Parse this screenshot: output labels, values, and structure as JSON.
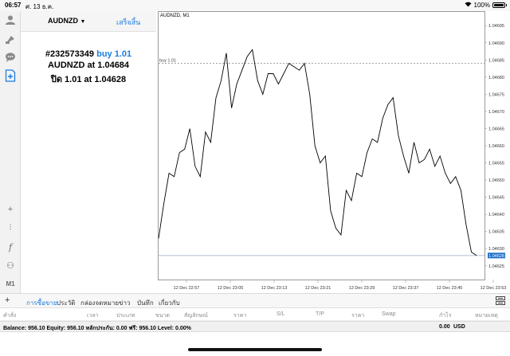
{
  "status": {
    "time": "06:57",
    "date": "ศ. 13 ธ.ค.",
    "battery": "100%"
  },
  "panel": {
    "symbol": "AUDNZD",
    "done": "เสร็จสิ้น",
    "order_id": "#232573349",
    "order_type": "buy 1.01",
    "open_line": "AUDNZD at 1.04684",
    "close_line": "ปิด 1.01 at 1.04628"
  },
  "chart_data": {
    "type": "line",
    "title": "AUDNZD, M1",
    "order_line_label": "buy 1.01",
    "order_price": 1.04684,
    "current_price": 1.04628,
    "ylim": [
      1.04621,
      1.04699
    ],
    "y_ticks": [
      "1.04695",
      "1.04690",
      "1.04685",
      "1.04680",
      "1.04675",
      "1.04670",
      "1.04665",
      "1.04660",
      "1.04655",
      "1.04650",
      "1.04645",
      "1.04640",
      "1.04635",
      "1.04630",
      "1.04625"
    ],
    "y_tick_values": [
      1.04695,
      1.0469,
      1.04685,
      1.0468,
      1.04675,
      1.0467,
      1.04665,
      1.0466,
      1.04655,
      1.0465,
      1.04645,
      1.0464,
      1.04635,
      1.0463,
      1.04625
    ],
    "x_labels": [
      "12 Dec 22:57",
      "12 Dec 23:05",
      "12 Dec 23:13",
      "12 Dec 23:21",
      "12 Dec 23:29",
      "12 Dec 23:37",
      "12 Dec 23:45",
      "12 Dec 23:53"
    ],
    "current_label": "1.04628",
    "values": [
      1.04633,
      1.04643,
      1.04652,
      1.04651,
      1.04658,
      1.04659,
      1.04665,
      1.04654,
      1.04651,
      1.04664,
      1.04661,
      1.04674,
      1.04679,
      1.04687,
      1.04671,
      1.04678,
      1.04682,
      1.04686,
      1.04688,
      1.04679,
      1.04675,
      1.04681,
      1.04681,
      1.04678,
      1.04681,
      1.04684,
      1.04683,
      1.04682,
      1.04684,
      1.04675,
      1.0466,
      1.04655,
      1.04657,
      1.04641,
      1.04636,
      1.04634,
      1.04647,
      1.04644,
      1.04652,
      1.04651,
      1.04658,
      1.04662,
      1.04661,
      1.04668,
      1.04672,
      1.04674,
      1.04663,
      1.04657,
      1.04652,
      1.04661,
      1.04655,
      1.04656,
      1.04659,
      1.04654,
      1.04657,
      1.04652,
      1.04649,
      1.04651,
      1.04647,
      1.04637,
      1.04629,
      1.04628
    ],
    "price_color": "#1f6fc9"
  },
  "tools": {
    "crosshair": "+",
    "candles": "⫶",
    "function": "f",
    "objects": "⚇",
    "timeframe": "M1"
  },
  "tabs": [
    "การซื้อขาย",
    "ประวัติ",
    "กล่องจดหมาย",
    "ข่าว",
    "บันทึก",
    "เกี่ยวกับ"
  ],
  "columns": [
    "คำสั่ง",
    "เวลา",
    "ประเภท",
    "ขนาด",
    "สัญลักษณ์",
    "ราคา",
    "S/L",
    "T/P",
    "ราคา",
    "Swap",
    "กำไร",
    "หมายเหตุ"
  ],
  "balance": {
    "summary": "Balance: 956.10 Equity: 956.10 หลักประกัน: 0.00 ฟรี: 956.10 Level: 0.00%",
    "total": "0.00",
    "currency": "USD"
  }
}
